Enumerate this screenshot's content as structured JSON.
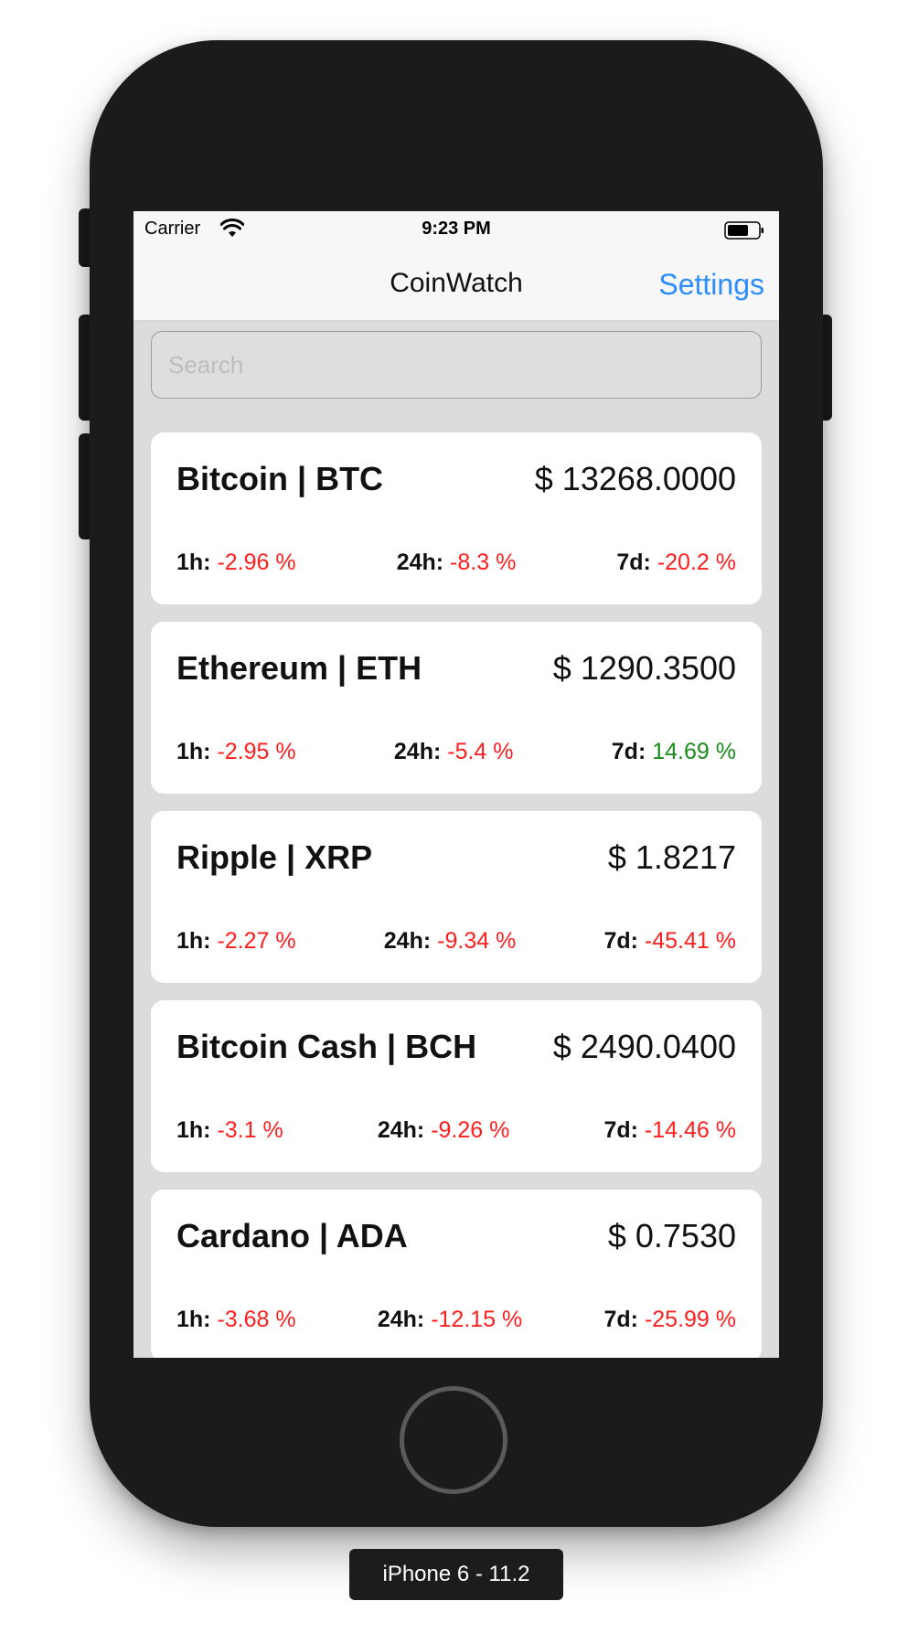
{
  "status_bar": {
    "carrier": "Carrier",
    "time": "9:23 PM"
  },
  "nav": {
    "title": "CoinWatch",
    "settings_label": "Settings"
  },
  "search": {
    "placeholder": "Search",
    "value": ""
  },
  "colors": {
    "accent": "#2d8cff",
    "negative": "#ff1e1e",
    "positive": "#1a8a1a"
  },
  "icons": {
    "wifi": "wifi-icon",
    "battery": "battery-icon"
  },
  "coins": [
    {
      "title": "Bitcoin | BTC",
      "price": "$ 13268.0000",
      "h1_label": "1h:",
      "h1": "-2.96 %",
      "h1_trend": "down",
      "h24_label": "24h:",
      "h24": "-8.3 %",
      "h24_trend": "down",
      "d7_label": "7d:",
      "d7": "-20.2 %",
      "d7_trend": "down"
    },
    {
      "title": "Ethereum | ETH",
      "price": "$ 1290.3500",
      "h1_label": "1h:",
      "h1": "-2.95 %",
      "h1_trend": "down",
      "h24_label": "24h:",
      "h24": "-5.4 %",
      "h24_trend": "down",
      "d7_label": "7d:",
      "d7": "14.69 %",
      "d7_trend": "up"
    },
    {
      "title": "Ripple | XRP",
      "price": "$ 1.8217",
      "h1_label": "1h:",
      "h1": "-2.27 %",
      "h1_trend": "down",
      "h24_label": "24h:",
      "h24": "-9.34 %",
      "h24_trend": "down",
      "d7_label": "7d:",
      "d7": "-45.41 %",
      "d7_trend": "down"
    },
    {
      "title": "Bitcoin Cash | BCH",
      "price": "$ 2490.0400",
      "h1_label": "1h:",
      "h1": "-3.1 %",
      "h1_trend": "down",
      "h24_label": "24h:",
      "h24": "-9.26 %",
      "h24_trend": "down",
      "d7_label": "7d:",
      "d7": "-14.46 %",
      "d7_trend": "down"
    },
    {
      "title": "Cardano | ADA",
      "price": "$ 0.7530",
      "h1_label": "1h:",
      "h1": "-3.68 %",
      "h1_trend": "down",
      "h24_label": "24h:",
      "h24": "-12.15 %",
      "h24_trend": "down",
      "d7_label": "7d:",
      "d7": "-25.99 %",
      "d7_trend": "down"
    }
  ],
  "device_label": "iPhone 6 - 11.2"
}
